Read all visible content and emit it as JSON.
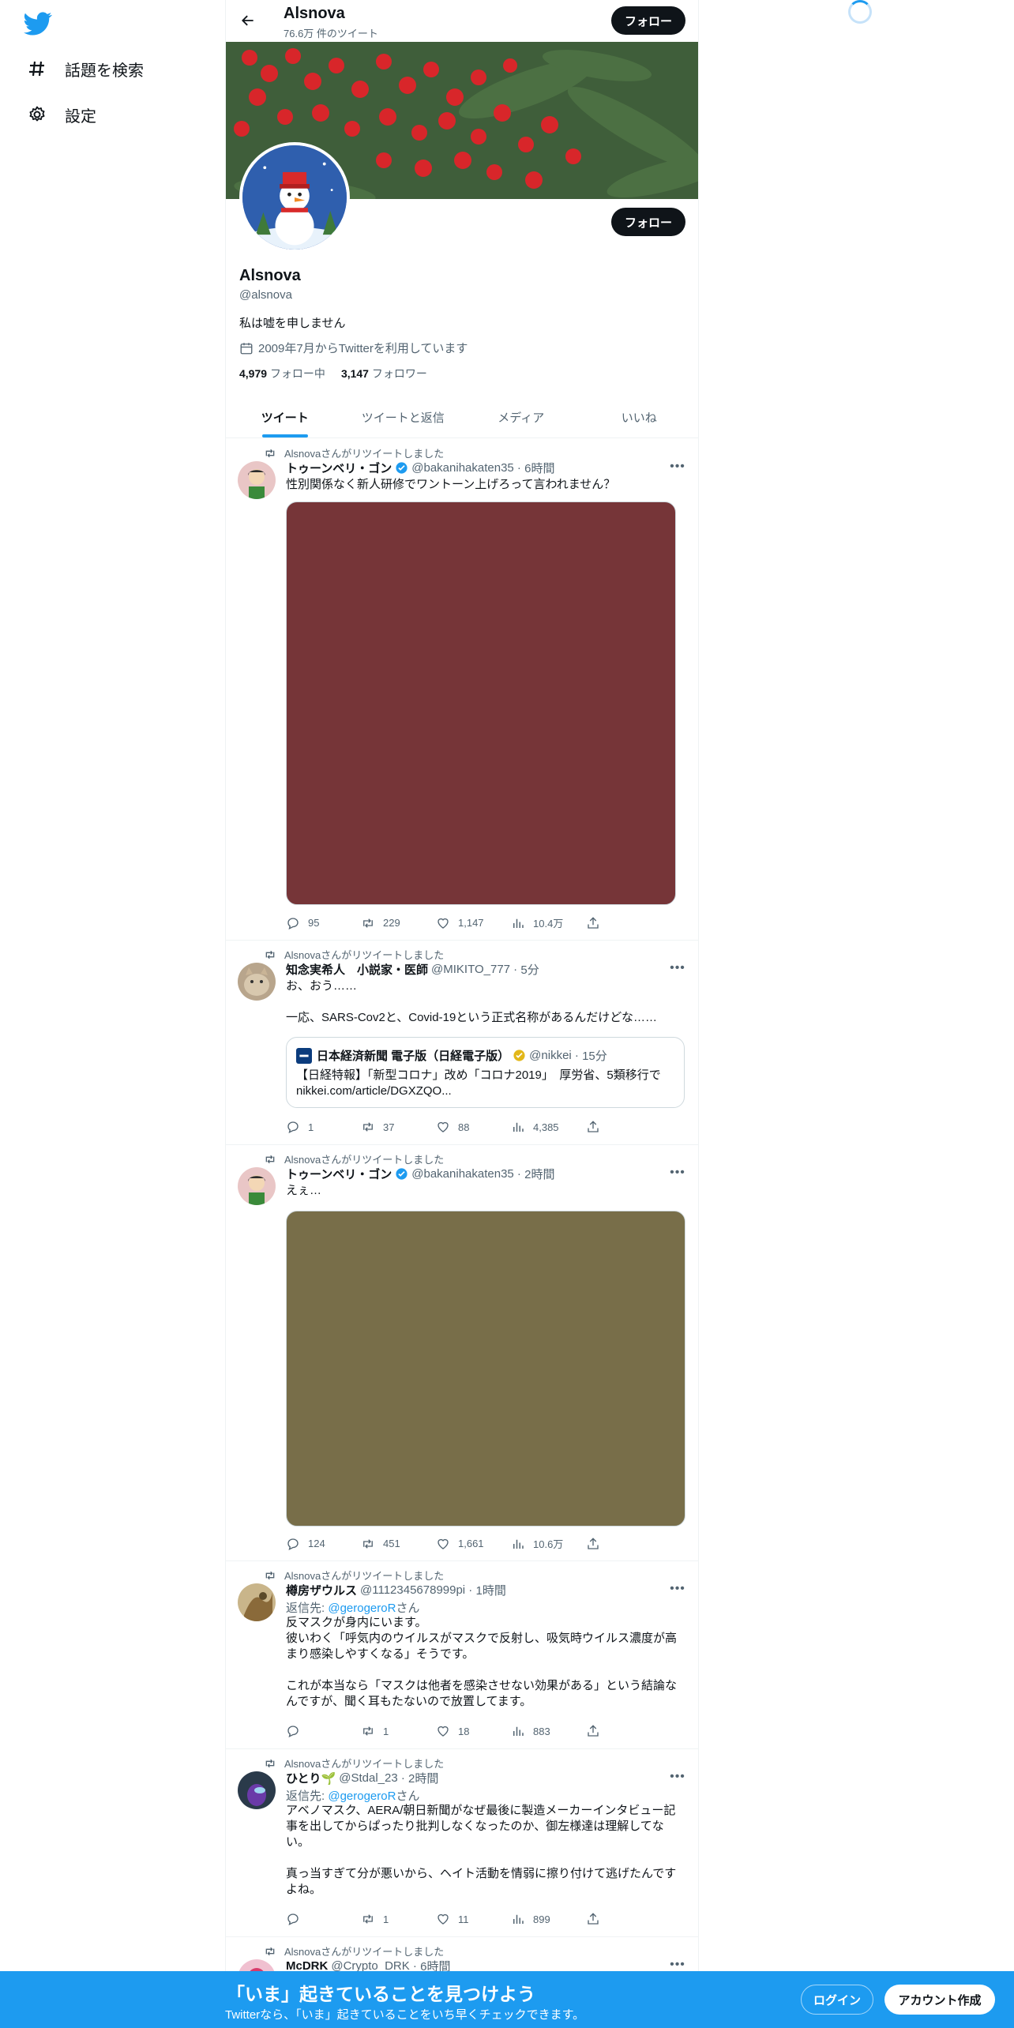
{
  "sidebar": {
    "explore_label": "話題を検索",
    "settings_label": "設定"
  },
  "header": {
    "name": "Alsnova",
    "tweet_count": "76.6万 件のツイート",
    "follow_label": "フォロー"
  },
  "profile": {
    "name": "Alsnova",
    "handle": "@alsnova",
    "bio": "私は嘘を申しません",
    "joined": "2009年7月からTwitterを利用しています",
    "following_count": "4,979",
    "following_label": "フォロー中",
    "followers_count": "3,147",
    "followers_label": "フォロワー",
    "follow_label": "フォロー"
  },
  "tabs": [
    "ツイート",
    "ツイートと返信",
    "メディア",
    "いいね"
  ],
  "retweet_text": "Alsnovaさんがリツイートしました",
  "tweets": [
    {
      "name": "トゥーンベリ・ゴン",
      "handle": "@bakanihakaten35",
      "time": "6時間",
      "text": "性別関係なく新人研修でワントーン上げろって言われません？",
      "media_color": "#763538",
      "replies": "95",
      "retweets": "229",
      "likes": "1,147",
      "views": "10.4万"
    },
    {
      "name": "知念実希人　小説家・医師",
      "handle": "@MIKITO_777",
      "time": "5分",
      "text": "お、おう……\n\n一応、SARS-Cov2と、Covid-19という正式名称があるんだけどな……",
      "quote_name": "日本経済新聞 電子版（日経電子版）",
      "quote_handle": "@nikkei",
      "quote_time": "15分",
      "quote_text": "【日経特報】「新型コロナ」改め「コロナ2019」　厚労省、5類移行で\nnikkei.com/article/DGXZQO...",
      "replies": "1",
      "retweets": "37",
      "likes": "88",
      "views": "4,385"
    },
    {
      "name": "トゥーンベリ・ゴン",
      "handle": "@bakanihakaten35",
      "time": "2時間",
      "text": "えぇ…",
      "media_color": "#786e49",
      "replies": "124",
      "retweets": "451",
      "likes": "1,661",
      "views": "10.6万"
    },
    {
      "name": "樽房ザウルス",
      "handle": "@1112345678999pi",
      "time": "1時間",
      "reply_prefix": "返信先: ",
      "reply_to": "@gerogeroR",
      "reply_suffix": "さん",
      "text": "反マスクが身内にいます。\n彼いわく「呼気内のウイルスがマスクで反射し、吸気時ウイルス濃度が高まり感染しやすくなる」そうです。\n\nこれが本当なら「マスクは他者を感染させない効果がある」という結論なんですが、聞く耳もたないので放置してます。",
      "replies": "",
      "retweets": "1",
      "likes": "18",
      "views": "883"
    },
    {
      "name": "ひとり🌱",
      "handle": "@Stdal_23",
      "time": "2時間",
      "reply_prefix": "返信先: ",
      "reply_to": "@gerogeroR",
      "reply_suffix": "さん",
      "text": "アベノマスク、AERA/朝日新聞がなぜ最後に製造メーカーインタビュー記事を出してからぱったり批判しなくなったのか、御左様達は理解してない。\n\n真っ当すぎて分が悪いから、ヘイト活動を情弱に擦り付けて逃げたんですよね。",
      "replies": "",
      "retweets": "1",
      "likes": "11",
      "views": "899"
    },
    {
      "name": "McDRK",
      "handle": "@Crypto_DRK",
      "time": "6時間"
    }
  ],
  "bottom_bar": {
    "title": "「いま」起きていることを見つけよう",
    "subtitle": "Twitterなら、「いま」起きていることをいち早くチェックできます。",
    "login": "ログイン",
    "signup": "アカウント作成"
  },
  "colors": {
    "accent": "#1d9bf0",
    "text": "#0f1419",
    "muted": "#536471"
  }
}
